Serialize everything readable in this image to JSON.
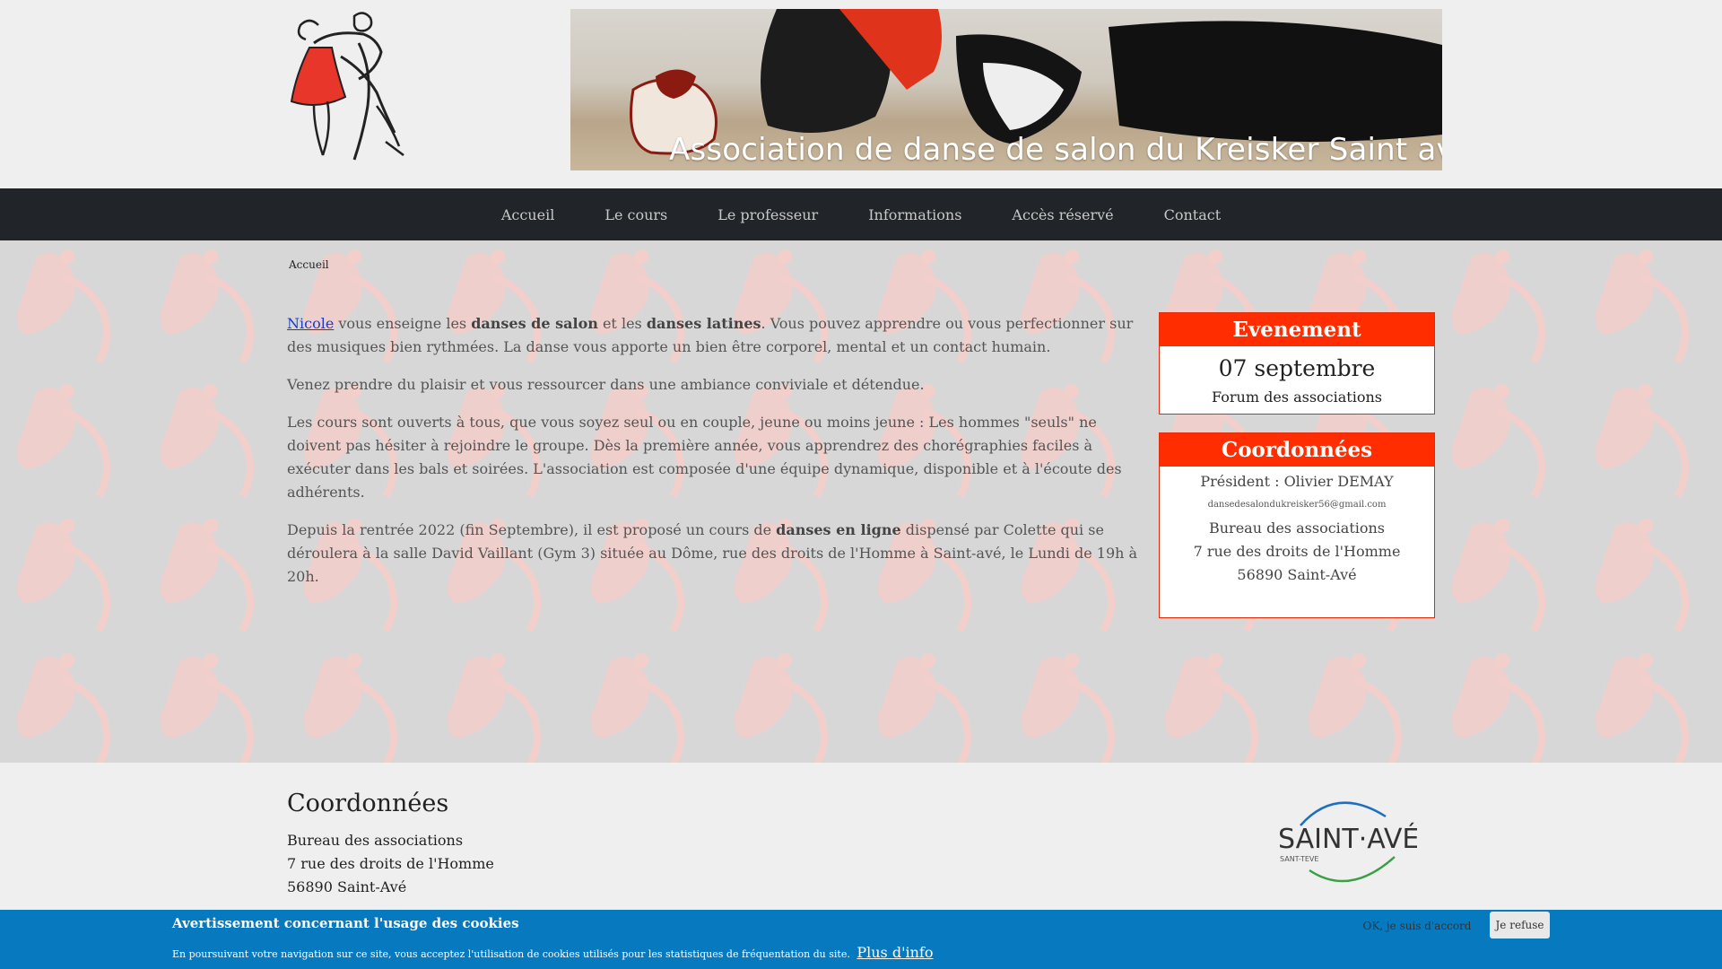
{
  "banner": {
    "title": "Association de danse de salon du Kreisker Saint avé"
  },
  "nav": {
    "items": [
      "Accueil",
      "Le cours",
      "Le professeur",
      "Informations",
      "Accès réservé",
      "Contact"
    ]
  },
  "breadcrumb": "Accueil",
  "content": {
    "p1": {
      "link": "Nicole",
      "t1": " vous enseigne les ",
      "b1": "danses de salon",
      "t2": " et les ",
      "b2": "danses latines",
      "t3": ". Vous pouvez apprendre ou vous perfectionner sur des musiques bien rythmées. La danse vous apporte un bien être corporel, mental et un contact humain."
    },
    "p2": "Venez prendre du plaisir et vous ressourcer dans une ambiance conviviale et détendue.",
    "p3": "Les cours sont ouverts à tous, que vous soyez seul ou en couple, jeune ou moins jeune : Les hommes \"seuls\" ne doivent pas hésiter à rejoindre le groupe. Dès la première année, vous apprendrez des chorégraphies faciles à exécuter dans les bals et soirées. L'association est composée d'une équipe dynamique, disponible et à l'écoute des adhérents.",
    "p4": {
      "t1": "Depuis la rentrée 2022 (fin Septembre), il est proposé un cours de ",
      "b1": "danses en ligne",
      "t2": " dispensé par Colette qui se déroulera à la salle David Vaillant (Gym 3) située au Dôme, rue des droits de l'Homme à Saint-avé, le Lundi de 19h à 20h."
    }
  },
  "event_box": {
    "title": "Evenement",
    "date": "07 septembre",
    "event": "Forum des associations"
  },
  "contact_box": {
    "title": "Coordonnées",
    "president": "Président : Olivier DEMAY",
    "email": "dansedesalondukreisker56@gmail.com",
    "addr1": "Bureau des associations",
    "addr2": "7 rue des droits de l'Homme",
    "addr3": "56890 Saint-Avé"
  },
  "footer": {
    "title": "Coordonnées",
    "addr1": "Bureau des associations",
    "addr2": "7 rue des droits de l'Homme",
    "addr3": "56890 Saint-Avé",
    "logo_main": "SAINT·AVÉ",
    "logo_sub": "SANT-TEVE"
  },
  "cookie": {
    "title": "Avertissement concernant l'usage des cookies",
    "text": "En poursuivant votre navigation sur ce site, vous acceptez l'utilisation de cookies utilisés pour les statistiques de fréquentation du site.",
    "more": "Plus d'info",
    "ok": "OK, je suis d'accord",
    "refuse": "Je refuse"
  },
  "colors": {
    "accent": "#ff2d00",
    "nav_bg": "#212529",
    "cookie_bg": "#0779bf",
    "link": "#1a3cc8"
  },
  "icons": {
    "logo": "dancing-couple-logo",
    "footer_logo": "saint-ave-logo"
  }
}
